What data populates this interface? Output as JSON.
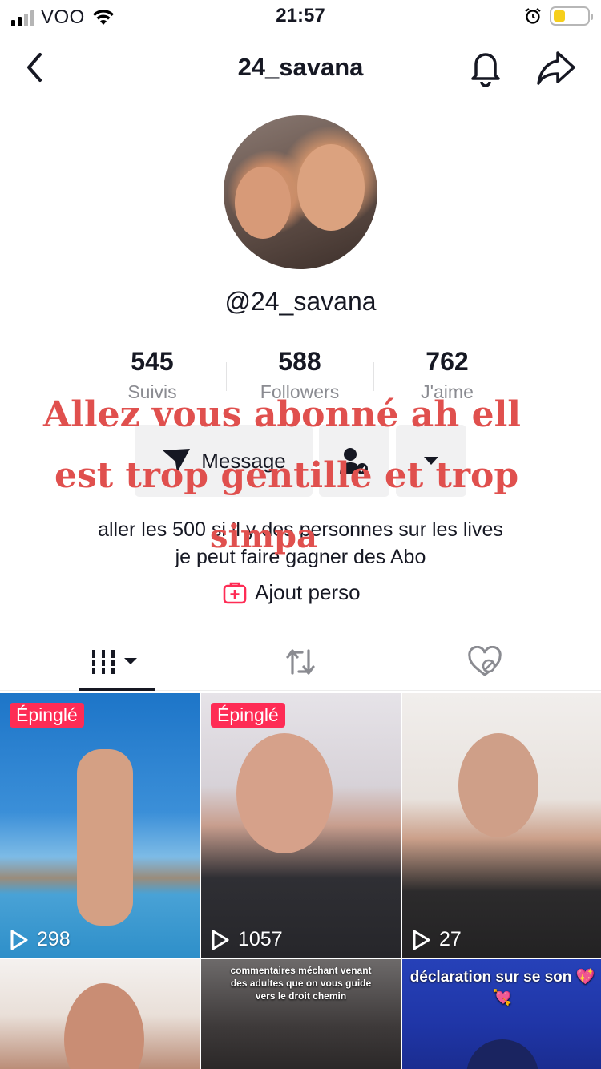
{
  "status_bar": {
    "carrier": "VOO",
    "time": "21:57",
    "battery_level": 0.34
  },
  "header": {
    "title": "24_savana"
  },
  "profile": {
    "username": "@24_savana"
  },
  "stats": [
    {
      "value": "545",
      "label": "Suivis"
    },
    {
      "value": "588",
      "label": "Followers"
    },
    {
      "value": "762",
      "label": "J'aime"
    }
  ],
  "actions": {
    "message_label": "Message"
  },
  "bio": {
    "line1": "aller les 500 si il y des personnes sur les lives",
    "line2": "je peut faire gagner des Abo",
    "add_perso": "Ajout perso"
  },
  "overlay_text": {
    "line1": "Allez vous abonné ah ell",
    "line2": "est trop gentille et trop",
    "line3": "simpa"
  },
  "videos": [
    {
      "pinned": true,
      "pin_label": "Épinglé",
      "views": "298"
    },
    {
      "pinned": true,
      "pin_label": "Épinglé",
      "views": "1057"
    },
    {
      "pinned": false,
      "views": "27"
    },
    {
      "pinned": false,
      "caption": ""
    },
    {
      "pinned": false,
      "caption": "commentaires méchant venant des adultes que on vous guide vers le droit chemin"
    },
    {
      "pinned": false,
      "caption": "déclaration sur se son 💖💘"
    }
  ],
  "colors": {
    "accent": "#fe2c55",
    "overlay": "#e0504e",
    "button_bg": "#f1f1f2"
  }
}
